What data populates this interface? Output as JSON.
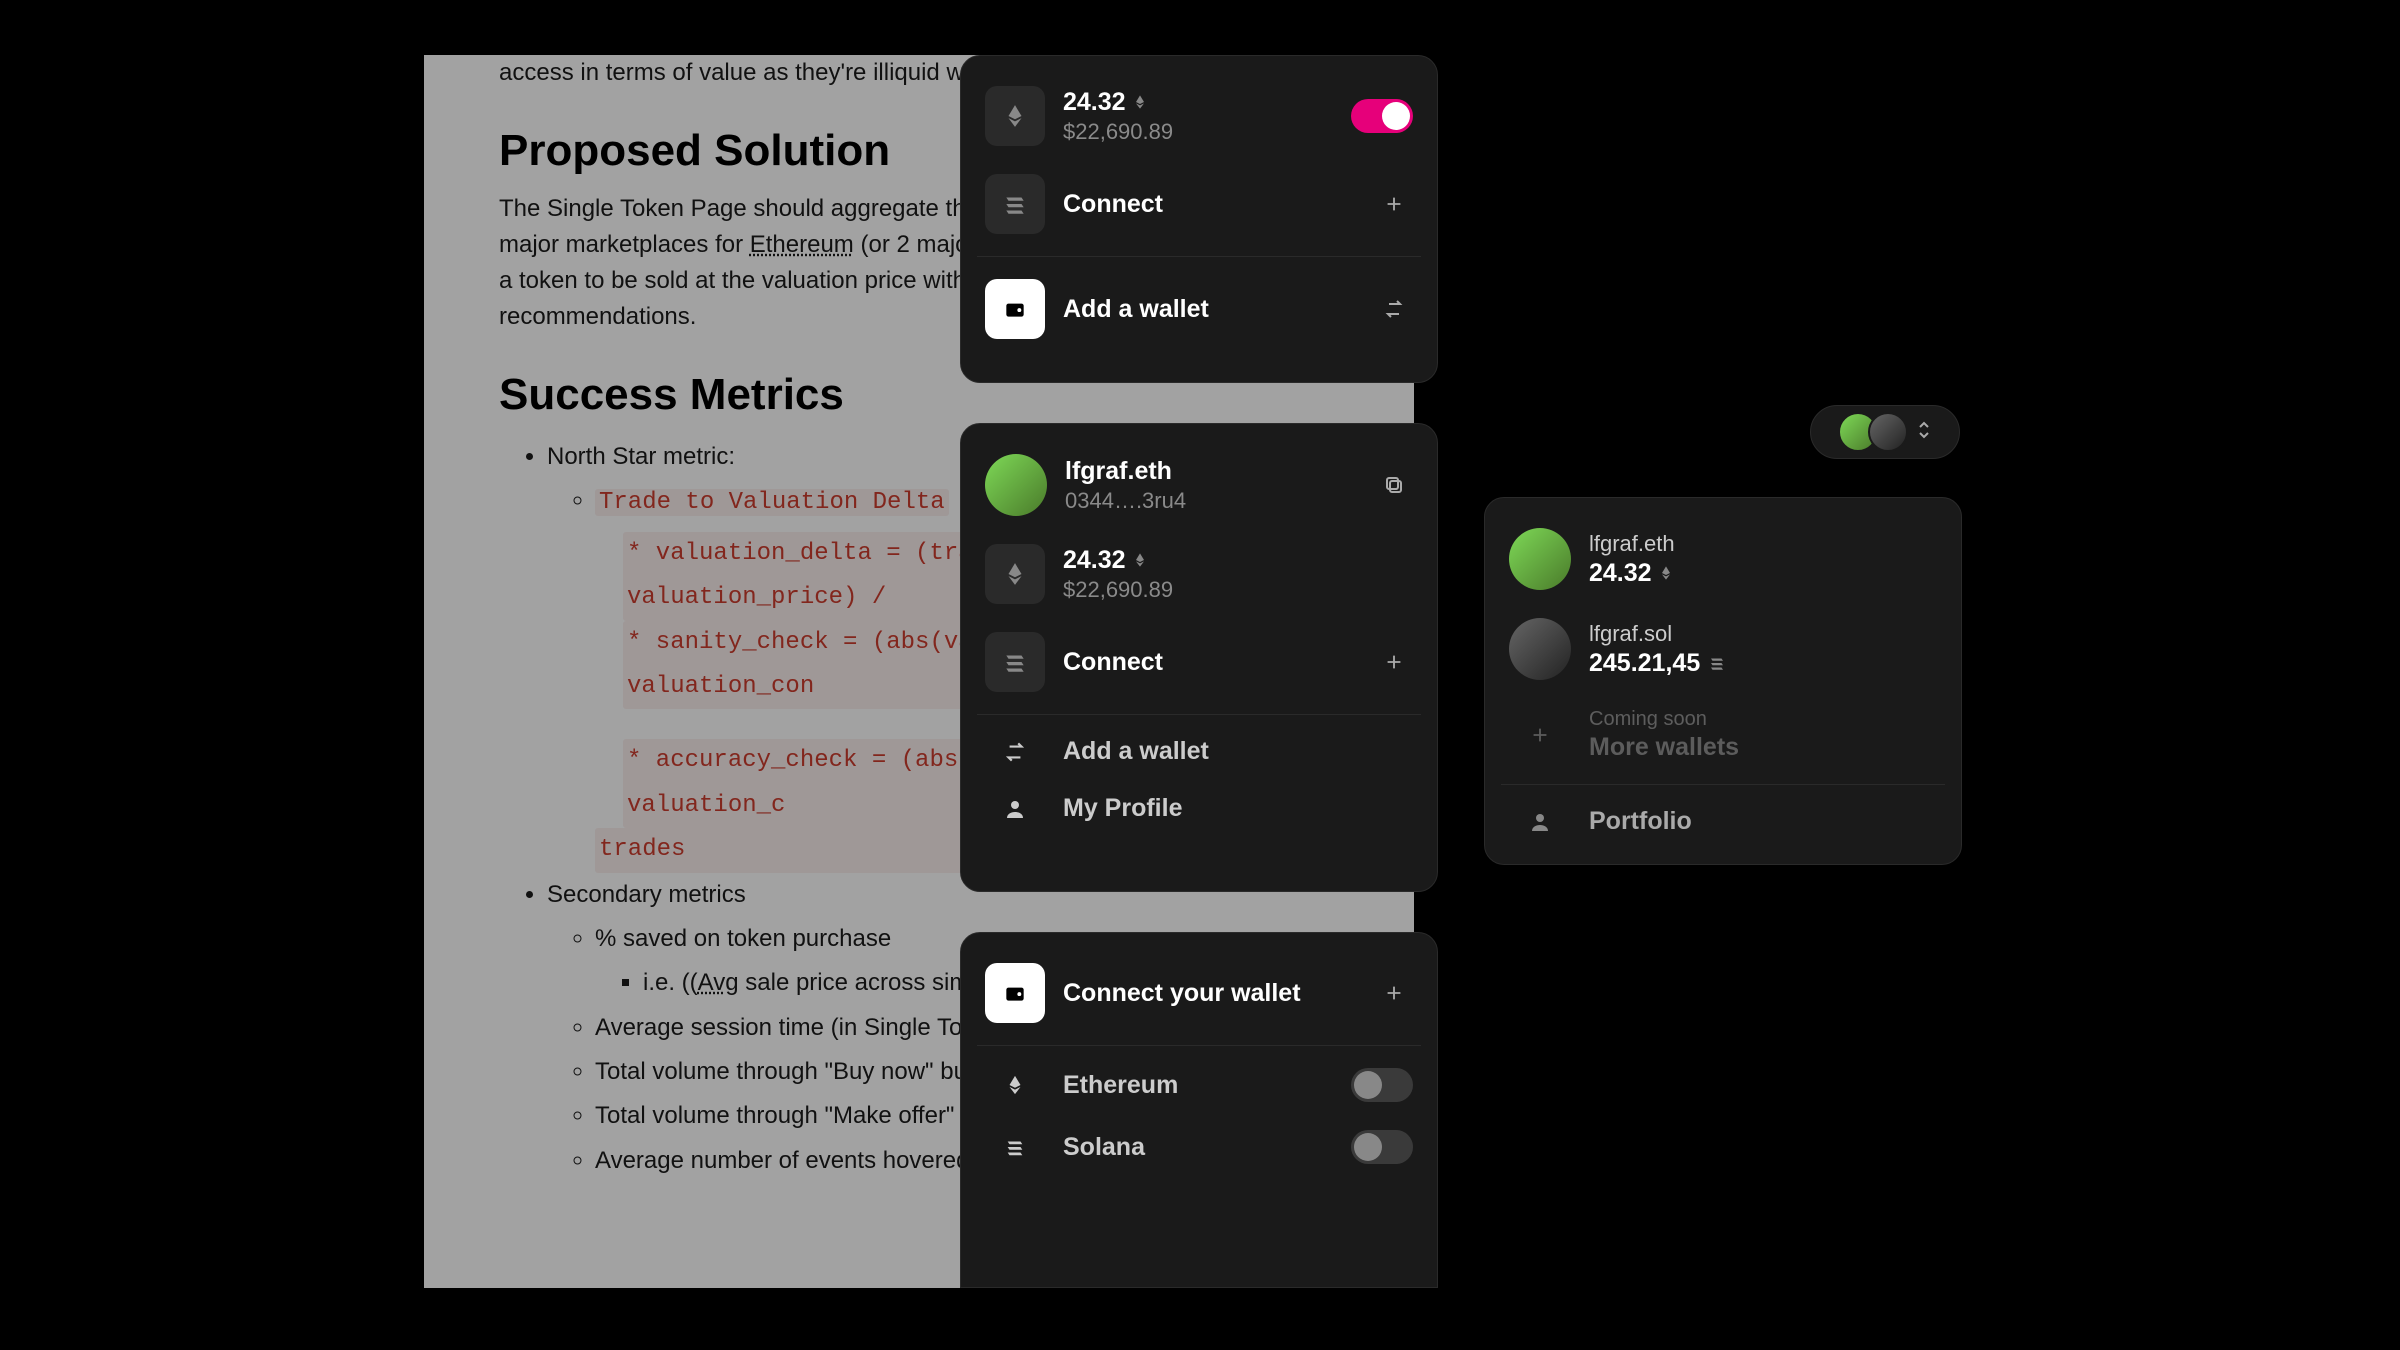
{
  "doc": {
    "intro_frag": "access in terms of value as they're illiquid without the analysis of values to",
    "h1": "Proposed Solution",
    "p1": "The Single Token Page should aggregate the current and historical market \n 3 major marketplaces for Ethereum (or 2 major marketplaces for Solana), re\ntake a token to be sold at the valuation price with a margin of error, and\nour price recommendations.",
    "h2": "Success Metrics",
    "north_star_label": "North Star metric:",
    "metric_code": "Trade to Valuation Delta",
    "code_l1": "* valuation_delta = (trade_price - valuation_price) /",
    "code_l2": "* sanity_check = (abs(valuation_delta) <= valuation_con",
    "code_l3": "* accuracy_check = (abs(valuation_delta) <= valuation_c",
    "code_l4": "trades",
    "secondary_label": "Secondary metrics",
    "sec1": "% saved on token purchase",
    "sec1_sub": "i.e. ((Avg sale price across similar tokens in collection) - (your s",
    "sec2": "Average session time (in Single Token modal)",
    "sec3": "Total volume through \"Buy now\" button",
    "sec4": "Total volume through \"Make offer\" button",
    "sec5": "Average number of events hovered over per modal session"
  },
  "card1": {
    "balance": "24.32",
    "balance_usd": "$22,690.89",
    "connect": "Connect",
    "add_wallet": "Add a wallet"
  },
  "card2": {
    "name": "lfgraf.eth",
    "addr": "0344….3ru4",
    "balance": "24.32",
    "balance_usd": "$22,690.89",
    "connect": "Connect",
    "add_wallet": "Add a wallet",
    "my_profile": "My Profile"
  },
  "card3": {
    "title": "Connect your wallet",
    "ethereum": "Ethereum",
    "solana": "Solana"
  },
  "card4": {
    "w1_name": "lfgraf.eth",
    "w1_bal": "24.32",
    "w2_name": "lfgraf.sol",
    "w2_bal": "245.21,45",
    "coming": "Coming soon",
    "more": "More wallets",
    "portfolio": "Portfolio"
  }
}
